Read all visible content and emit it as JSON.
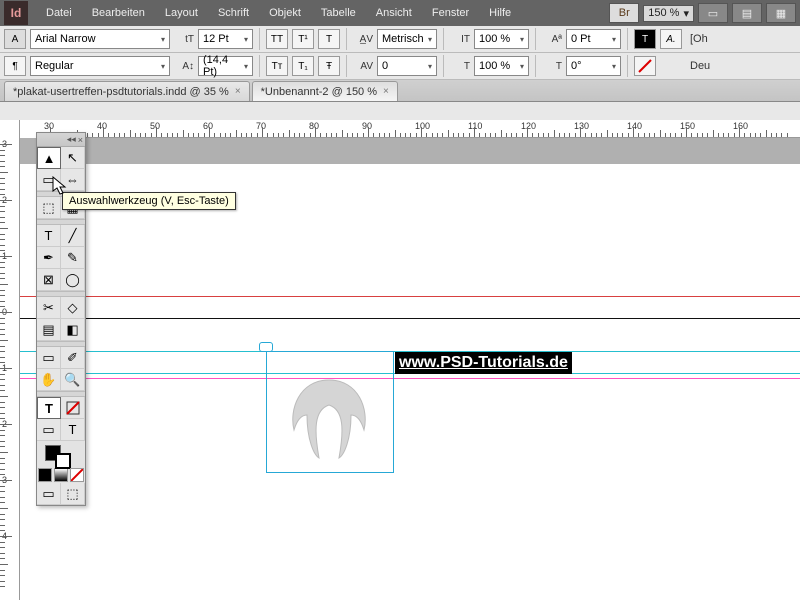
{
  "app_icon": "Id",
  "menus": [
    "Datei",
    "Bearbeiten",
    "Layout",
    "Schrift",
    "Objekt",
    "Tabelle",
    "Ansicht",
    "Fenster",
    "Hilfe"
  ],
  "menubar_buttons": {
    "br": "Br"
  },
  "zoom": "150 %",
  "control": {
    "font": "Arial Narrow",
    "font_style": "Regular",
    "size_icon": "tT",
    "size": "12 Pt",
    "leading_icon": "A↕",
    "leading": "(14,4 Pt)",
    "tt_btns": [
      "TT",
      "T¹",
      "T"
    ],
    "tt2_btns": [
      "Tт",
      "T₁",
      "Ŧ"
    ],
    "kerning_icon": "A̲V",
    "tracking_icon": "AV",
    "kerning": "Metrisch",
    "tracking": "0",
    "vscale_icon": "IT",
    "hscale_icon": "T",
    "vscale": "100 %",
    "hscale": "100 %",
    "baseline_icon": "Aª",
    "skew_icon": "T",
    "baseline": "0 Pt",
    "skew": "0°",
    "right_labels": [
      "[Oh",
      "Deu"
    ]
  },
  "tabs": [
    {
      "label": "*plakat-usertreffen-psdtutorials.indd @ 35 %",
      "active": false
    },
    {
      "label": "*Unbenannt-2 @ 150 %",
      "active": true
    }
  ],
  "ruler_h": [
    30,
    40,
    50,
    60,
    70,
    80,
    90,
    100,
    110,
    120,
    130,
    140,
    150,
    160
  ],
  "ruler_v": [
    3,
    2,
    1,
    0,
    1,
    2,
    3,
    4
  ],
  "tooltip": "Auswahlwerkzeug (V, Esc-Taste)",
  "canvas": {
    "url_text": "www.PSD-Tutorials.de"
  },
  "tools": {
    "names": [
      "selection",
      "direct-selection",
      "page",
      "gap",
      "content-collector",
      "content-grid",
      "type",
      "line",
      "pen",
      "pencil",
      "rectangle-frame",
      "ellipse",
      "scissors",
      "free-transform",
      "gradient-swatch",
      "gradient-feather",
      "note",
      "eyedropper",
      "hand",
      "zoom"
    ],
    "glyphs": [
      "▲",
      "↖",
      "▭",
      "⇔",
      "⬚",
      "▦",
      "T",
      "╱",
      "✒",
      "✎",
      "⊠",
      "◯",
      "✂",
      "◇",
      "▤",
      "◧",
      "▭",
      "✐",
      "✋",
      "🔍"
    ]
  }
}
